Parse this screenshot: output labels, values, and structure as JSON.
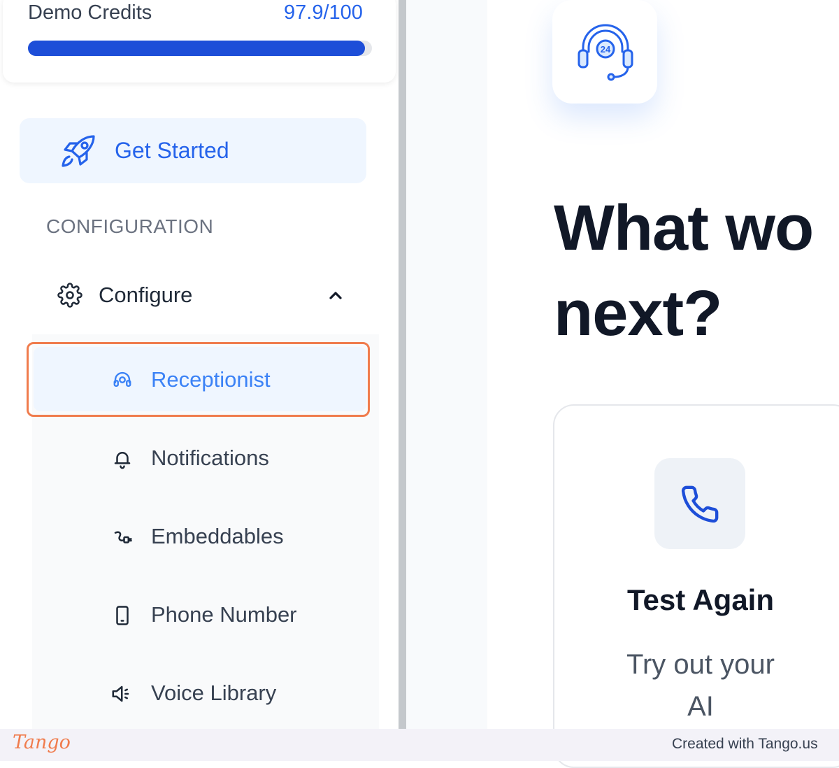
{
  "sidebar": {
    "credits": {
      "label": "Demo Credits",
      "value": "97.9/100",
      "fill_fraction": 0.979
    },
    "get_started": "Get Started",
    "section_title": "CONFIGURATION",
    "configure": "Configure",
    "submenu": [
      {
        "label": "Receptionist",
        "icon": "headset-icon",
        "selected": true
      },
      {
        "label": "Notifications",
        "icon": "bell-icon"
      },
      {
        "label": "Embeddables",
        "icon": "plug-icon"
      },
      {
        "label": "Phone Number",
        "icon": "smartphone-icon"
      },
      {
        "label": "Voice Library",
        "icon": "speaker-icon"
      }
    ]
  },
  "main": {
    "heading_line1": "What wo",
    "heading_line2": "next?",
    "card": {
      "title": "Test Again",
      "description_line1": "Try out your",
      "description_line2": "AI"
    }
  },
  "footer": {
    "logo": "Tango",
    "credit": "Created with Tango.us"
  },
  "colors": {
    "accent": "#2563eb",
    "highlight": "#f07c4d",
    "selected_bg": "#eff6ff"
  }
}
